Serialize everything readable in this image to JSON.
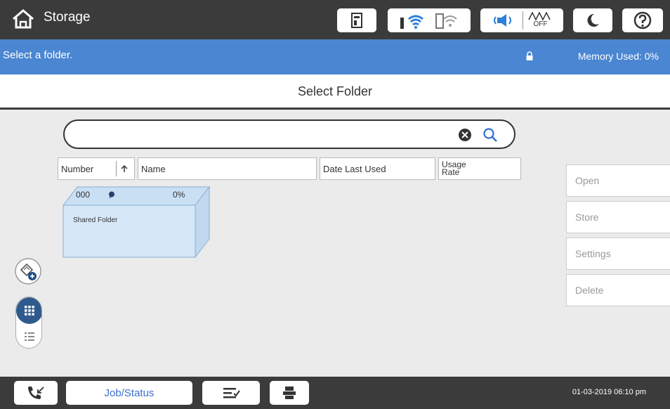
{
  "header": {
    "title": "Storage",
    "icons": [
      "home-icon",
      "toner-icon",
      "wifi-icon",
      "wifi-direct-icon",
      "volume-icon",
      "quiet-mode-off-icon",
      "sleep-icon",
      "help-icon"
    ],
    "quiet_off_label": "OFF"
  },
  "infobar": {
    "message": "Select a folder.",
    "memory": "Memory Used: 0%"
  },
  "page": {
    "title": "Select Folder"
  },
  "search": {
    "value": "",
    "placeholder": ""
  },
  "columns": {
    "number": "Number",
    "name": "Name",
    "date": "Date Last Used",
    "usage": "Usage Rate"
  },
  "folders": [
    {
      "number": "000",
      "usage": "0%",
      "name": "Shared Folder"
    }
  ],
  "actions": {
    "open": "Open",
    "store": "Store",
    "settings": "Settings",
    "delete": "Delete"
  },
  "bottom": {
    "job_status": "Job/Status",
    "datetime": "01-03-2019 06:10 pm"
  },
  "colors": {
    "header_bg": "#3b3b3b",
    "info_bg": "#4a86d2",
    "folder_bg": "#d6e8f8",
    "accent": "#3b6fcf",
    "view_active": "#2e5a8e"
  }
}
